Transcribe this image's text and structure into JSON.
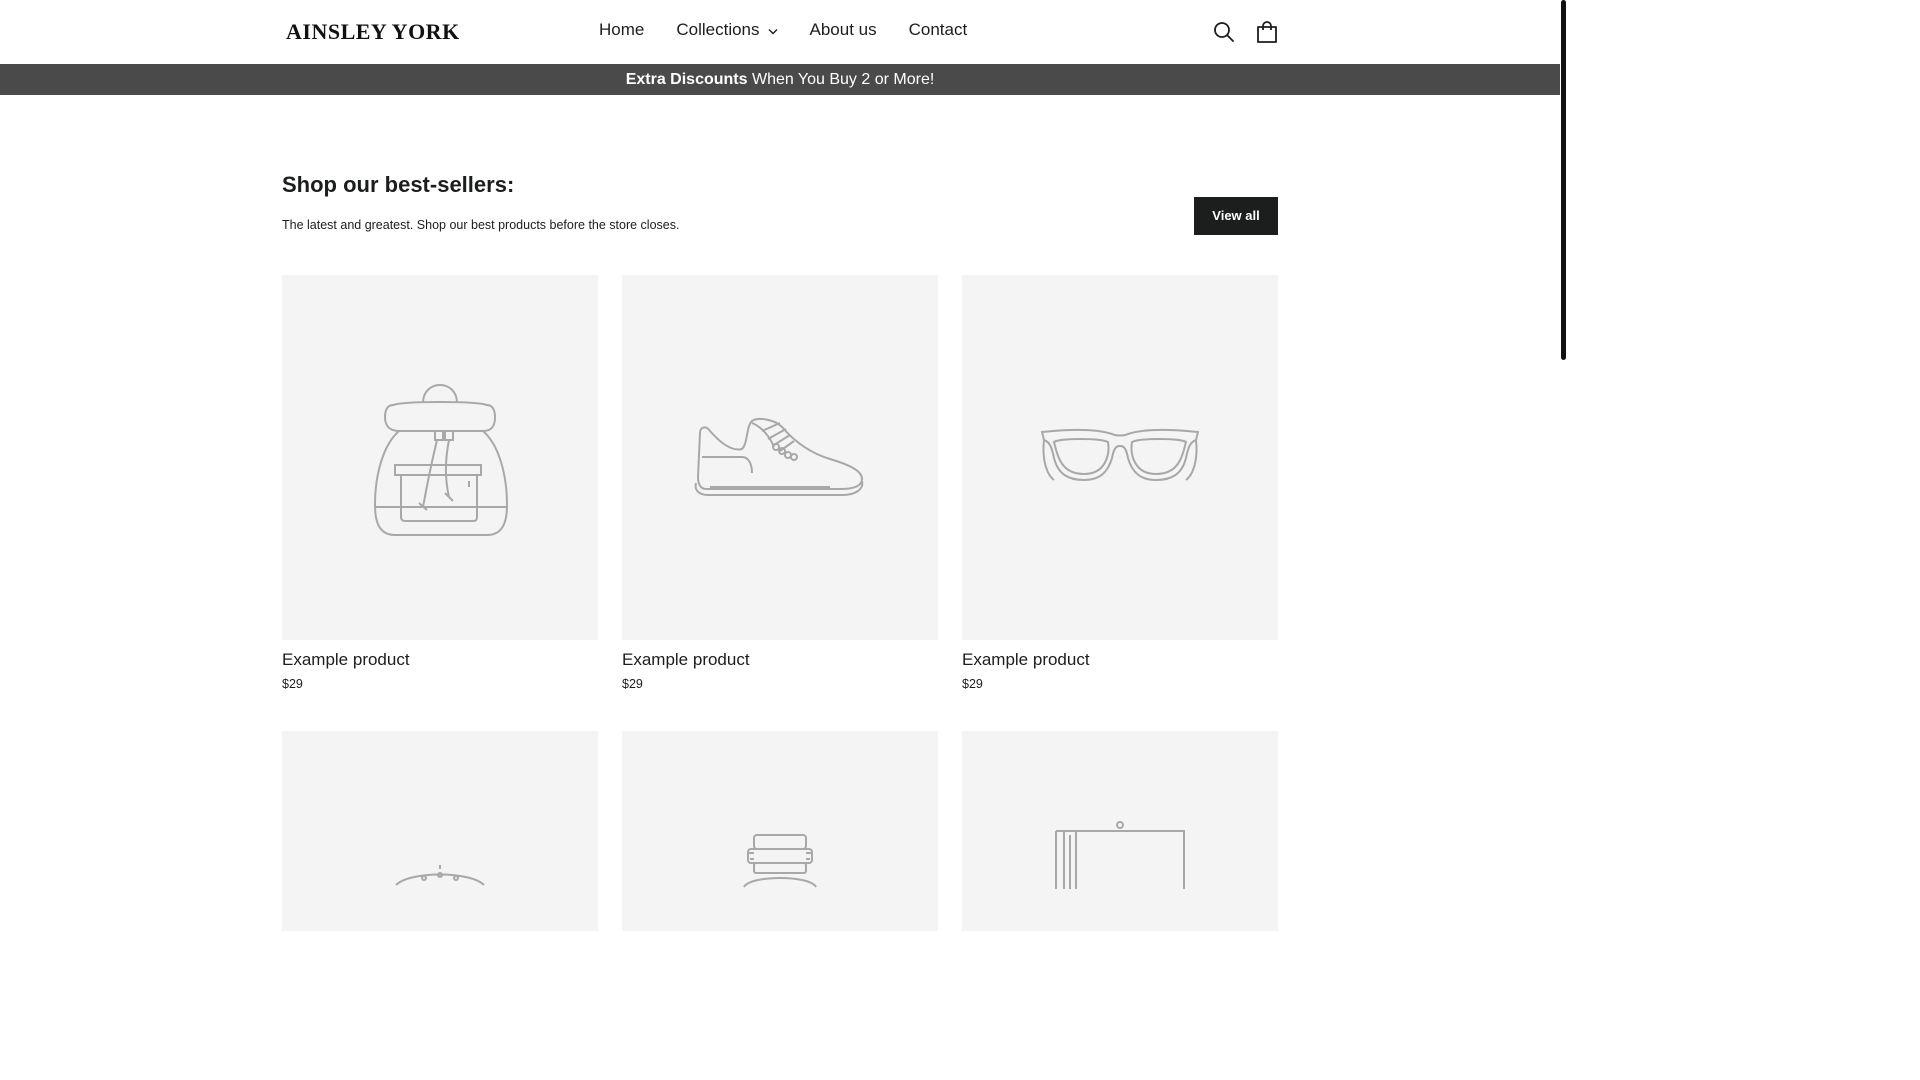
{
  "header": {
    "logo": "AINSLEY YORK",
    "nav": [
      {
        "label": "Home"
      },
      {
        "label": "Collections"
      },
      {
        "label": "About us"
      },
      {
        "label": "Contact"
      }
    ],
    "icons": [
      "search-icon",
      "cart-icon"
    ]
  },
  "announcement": {
    "bold": "Extra Discounts",
    "rest": " When You Buy 2 or More!"
  },
  "section": {
    "title": "Shop our best-sellers:",
    "subtitle": "The latest and greatest. Shop our best products before the store closes.",
    "view_all": "View all"
  },
  "products": [
    {
      "name": "Example product",
      "price": "$29",
      "icon": "backpack-icon"
    },
    {
      "name": "Example product",
      "price": "$29",
      "icon": "sneaker-icon"
    },
    {
      "name": "Example product",
      "price": "$29",
      "icon": "sunglasses-icon"
    }
  ],
  "products_row2": [
    {
      "icon": "wall-clock-icon"
    },
    {
      "icon": "wristwatch-icon"
    },
    {
      "icon": "hanging-frame-icon"
    }
  ],
  "colors": {
    "text": "#1c1d1d",
    "announcement_bg": "#4a4a4a",
    "button_bg": "#1c1d1d",
    "image_bg": "#f4f4f4",
    "illustration_stroke": "#a8a8a8"
  }
}
